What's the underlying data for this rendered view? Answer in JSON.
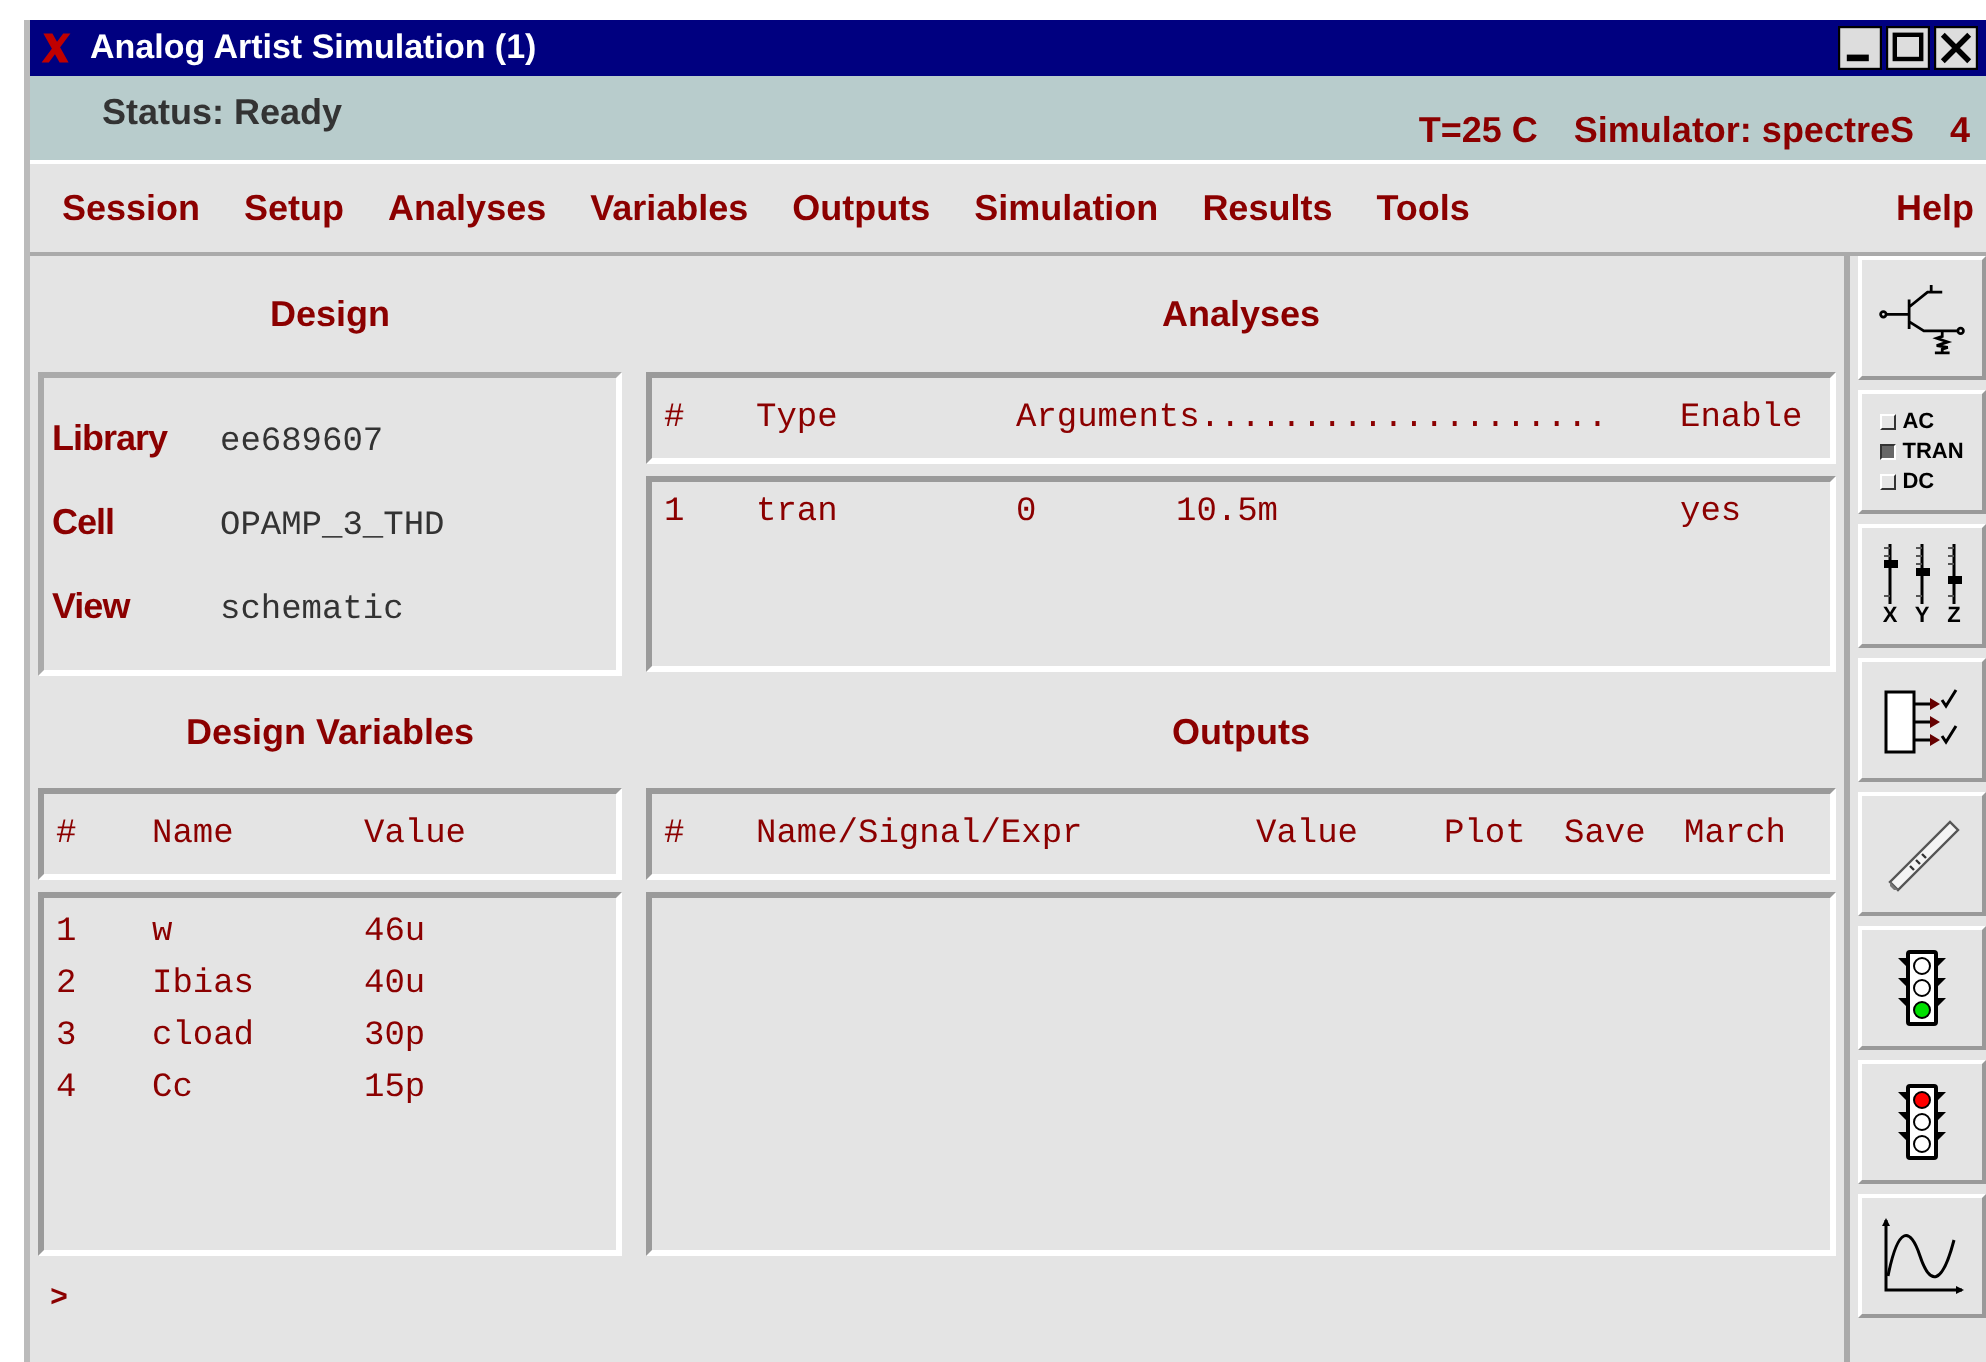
{
  "window": {
    "title": "Analog Artist Simulation (1)"
  },
  "status_bar": {
    "status": "Status: Ready",
    "temperature": "T=25 C",
    "simulator": "Simulator: spectreS",
    "number": "4"
  },
  "menu": [
    "Session",
    "Setup",
    "Analyses",
    "Variables",
    "Outputs",
    "Simulation",
    "Results",
    "Tools",
    "Help"
  ],
  "design": {
    "title": "Design",
    "fields": [
      {
        "label": "Library",
        "value": "ee689607"
      },
      {
        "label": "Cell",
        "value": "OPAMP_3_THD"
      },
      {
        "label": "View",
        "value": "schematic"
      }
    ]
  },
  "analyses": {
    "title": "Analyses",
    "columns": [
      "#",
      "Type",
      "Arguments....................",
      "Enable"
    ],
    "rows": [
      {
        "index": "1",
        "type": "tran",
        "arguments": [
          "0",
          "10.5m"
        ],
        "enable": "yes"
      }
    ]
  },
  "design_variables": {
    "title": "Design Variables",
    "columns": [
      "#",
      "Name",
      "Value"
    ],
    "rows": [
      {
        "index": "1",
        "name": "w",
        "value": "46u"
      },
      {
        "index": "2",
        "name": "Ibias",
        "value": "40u"
      },
      {
        "index": "3",
        "name": "cload",
        "value": "30p"
      },
      {
        "index": "4",
        "name": "Cc",
        "value": "15p"
      }
    ]
  },
  "outputs": {
    "title": "Outputs",
    "columns": [
      "#",
      "Name/Signal/Expr",
      "Value",
      "Plot",
      "Save",
      "March"
    ]
  },
  "command_prompt": ">",
  "toolbar": [
    {
      "kind": "schematic"
    },
    {
      "kind": "analyses",
      "options": [
        {
          "label": "AC",
          "selected": false
        },
        {
          "label": "TRAN",
          "selected": true
        },
        {
          "label": "DC",
          "selected": false
        }
      ]
    },
    {
      "kind": "sliders",
      "labels": [
        "X",
        "Y",
        "Z"
      ]
    },
    {
      "kind": "outputs"
    },
    {
      "kind": "netlist"
    },
    {
      "kind": "run"
    },
    {
      "kind": "stop"
    },
    {
      "kind": "plot"
    }
  ]
}
